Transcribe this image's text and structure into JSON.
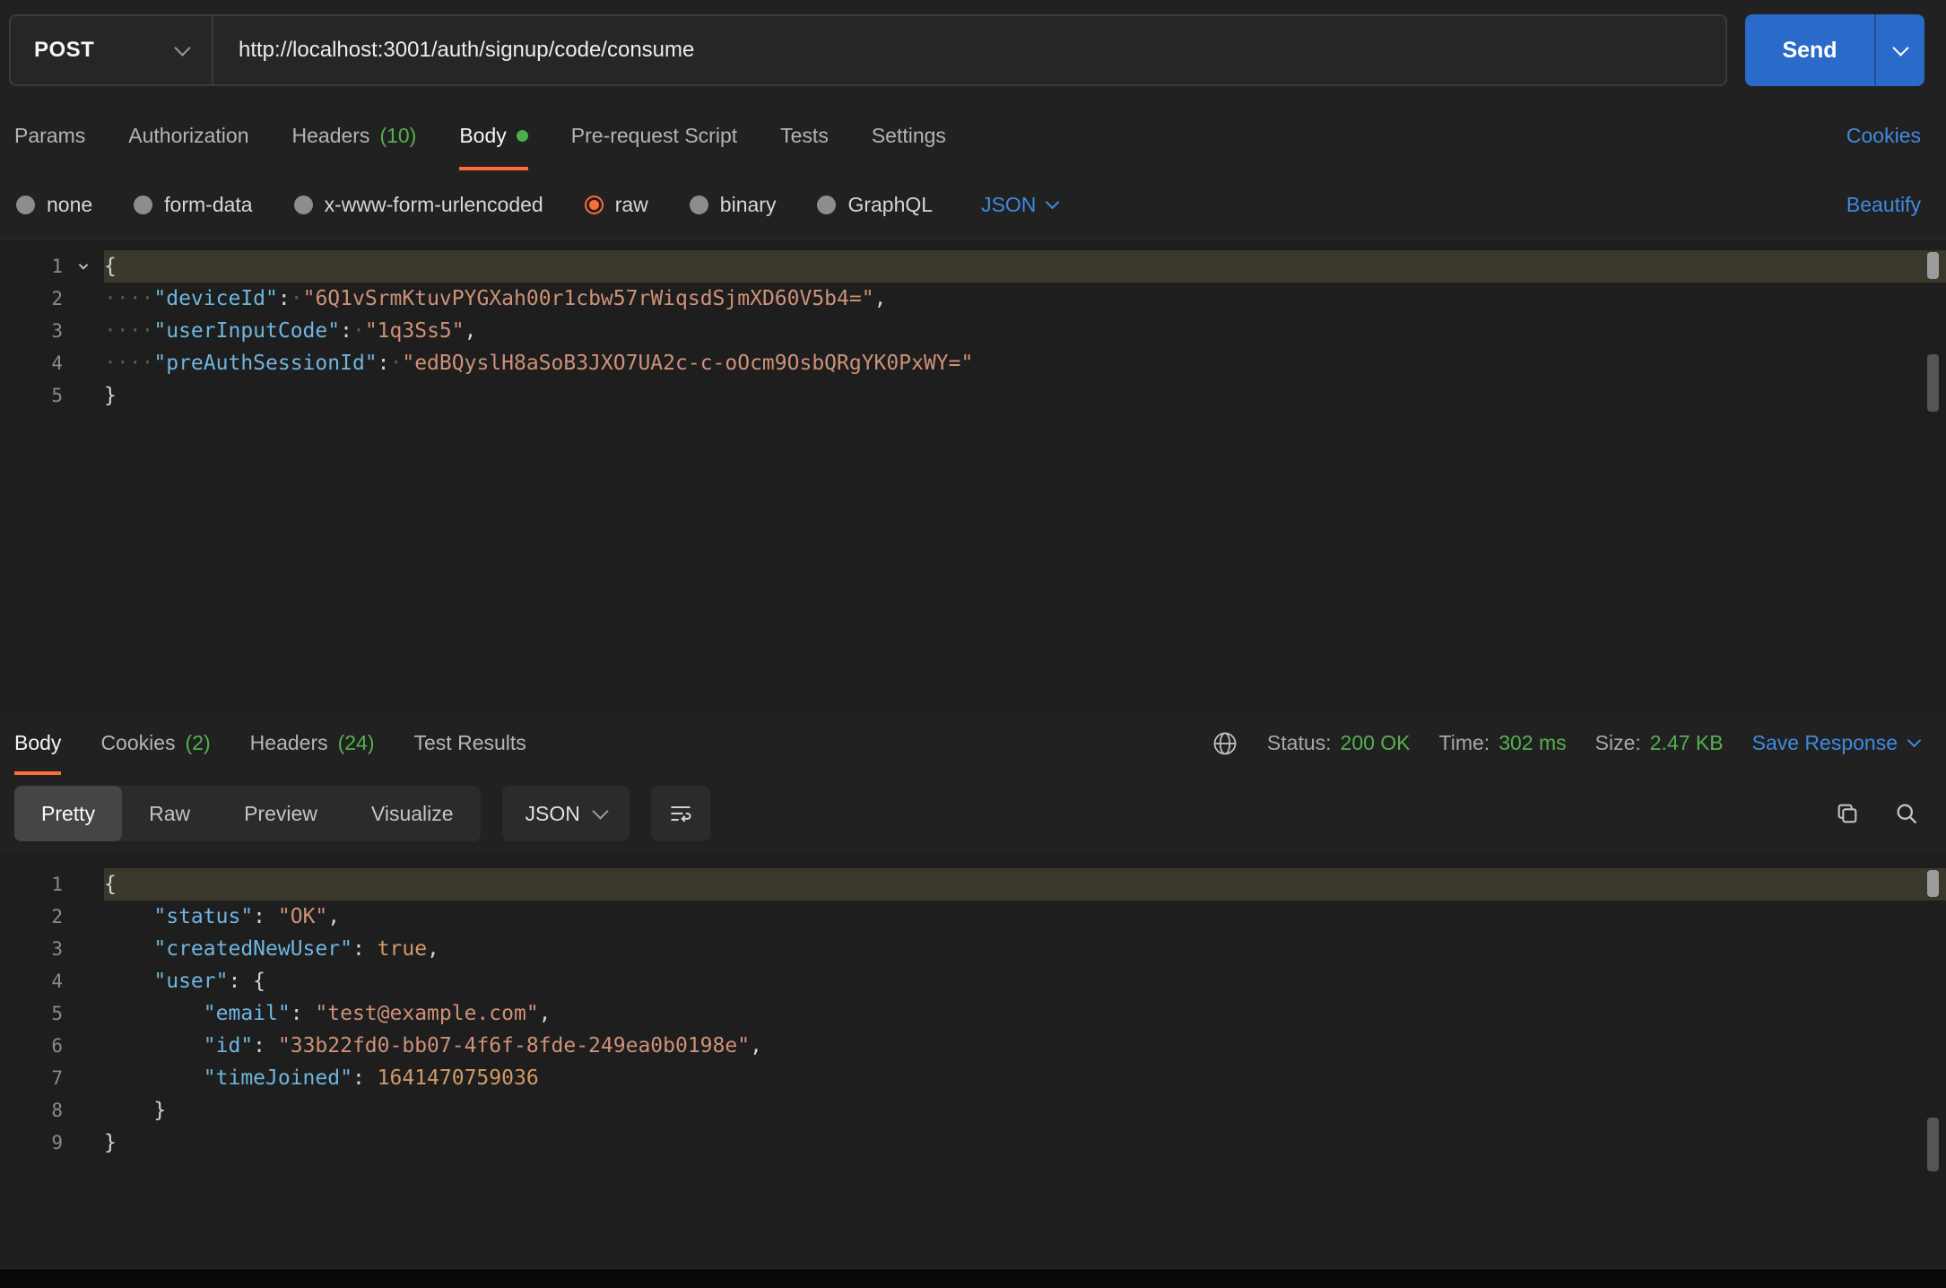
{
  "request_bar": {
    "method": "POST",
    "url": "http://localhost:3001/auth/signup/code/consume",
    "send": "Send"
  },
  "request_tabs": {
    "params": "Params",
    "authorization": "Authorization",
    "headers": "Headers",
    "headers_count": "(10)",
    "body": "Body",
    "prerequest_script": "Pre-request Script",
    "tests": "Tests",
    "settings": "Settings",
    "cookies_link": "Cookies"
  },
  "body_type_bar": {
    "none": "none",
    "form_data": "form-data",
    "x_www_form_urlencoded": "x-www-form-urlencoded",
    "raw": "raw",
    "selected_option": "raw",
    "binary": "binary",
    "graphql": "GraphQL",
    "language": "JSON",
    "beautify": "Beautify"
  },
  "request_editor": {
    "lines": [
      {
        "current": true,
        "fold": true,
        "tokens": [
          [
            "pun",
            "{"
          ]
        ]
      },
      {
        "tokens": [
          [
            "ws",
            "····"
          ],
          [
            "key",
            "\"deviceId\""
          ],
          [
            "pun",
            ":"
          ],
          [
            "ws",
            "·"
          ],
          [
            "str",
            "\"6Q1vSrmKtuvPYGXah00r1cbw57rWiqsdSjmXD60V5b4=\""
          ],
          [
            "pun",
            ","
          ]
        ]
      },
      {
        "tokens": [
          [
            "ws",
            "····"
          ],
          [
            "key",
            "\"userInputCode\""
          ],
          [
            "pun",
            ":"
          ],
          [
            "ws",
            "·"
          ],
          [
            "str",
            "\"1q3Ss5\""
          ],
          [
            "pun",
            ","
          ]
        ]
      },
      {
        "tokens": [
          [
            "ws",
            "····"
          ],
          [
            "key",
            "\"preAuthSessionId\""
          ],
          [
            "pun",
            ":"
          ],
          [
            "ws",
            "·"
          ],
          [
            "str",
            "\"edBQyslH8aSoB3JXO7UA2c-c-oOcm9OsbQRgYK0PxWY=\""
          ]
        ]
      },
      {
        "tokens": [
          [
            "pun",
            "}"
          ]
        ]
      }
    ]
  },
  "response_tabs": {
    "body": "Body",
    "cookies": "Cookies",
    "cookies_count": "(2)",
    "headers": "Headers",
    "headers_count": "(24)",
    "test_results": "Test Results"
  },
  "response_meta": {
    "status_label": "Status:",
    "status_value": "200 OK",
    "time_label": "Time:",
    "time_value": "302 ms",
    "size_label": "Size:",
    "size_value": "2.47 KB",
    "save_response": "Save Response"
  },
  "response_toolbar": {
    "pretty": "Pretty",
    "raw": "Raw",
    "preview": "Preview",
    "visualize": "Visualize",
    "language": "JSON"
  },
  "response_editor": {
    "lines": [
      {
        "current": true,
        "tokens": [
          [
            "pun",
            "{"
          ]
        ]
      },
      {
        "tokens": [
          [
            "ws",
            "    "
          ],
          [
            "key",
            "\"status\""
          ],
          [
            "pun",
            ": "
          ],
          [
            "str",
            "\"OK\""
          ],
          [
            "pun",
            ","
          ]
        ]
      },
      {
        "tokens": [
          [
            "ws",
            "    "
          ],
          [
            "key",
            "\"createdNewUser\""
          ],
          [
            "pun",
            ": "
          ],
          [
            "bool",
            "true"
          ],
          [
            "pun",
            ","
          ]
        ]
      },
      {
        "tokens": [
          [
            "ws",
            "    "
          ],
          [
            "key",
            "\"user\""
          ],
          [
            "pun",
            ": {"
          ]
        ]
      },
      {
        "tokens": [
          [
            "ws",
            "        "
          ],
          [
            "key",
            "\"email\""
          ],
          [
            "pun",
            ": "
          ],
          [
            "str",
            "\"test@example.com\""
          ],
          [
            "pun",
            ","
          ]
        ]
      },
      {
        "tokens": [
          [
            "ws",
            "        "
          ],
          [
            "key",
            "\"id\""
          ],
          [
            "pun",
            ": "
          ],
          [
            "str",
            "\"33b22fd0-bb07-4f6f-8fde-249ea0b0198e\""
          ],
          [
            "pun",
            ","
          ]
        ]
      },
      {
        "tokens": [
          [
            "ws",
            "        "
          ],
          [
            "key",
            "\"timeJoined\""
          ],
          [
            "pun",
            ": "
          ],
          [
            "num",
            "1641470759036"
          ]
        ]
      },
      {
        "tokens": [
          [
            "ws",
            "    "
          ],
          [
            "pun",
            "}"
          ]
        ]
      },
      {
        "tokens": [
          [
            "pun",
            "}"
          ]
        ]
      }
    ]
  },
  "colors": {
    "accent_orange": "#ff6c37",
    "success_green": "#55b04f",
    "link_blue": "#3f8ae0",
    "send_button_blue": "#2a6bc9",
    "key_blue": "#6fb5de",
    "string_orange": "#ce9178"
  }
}
